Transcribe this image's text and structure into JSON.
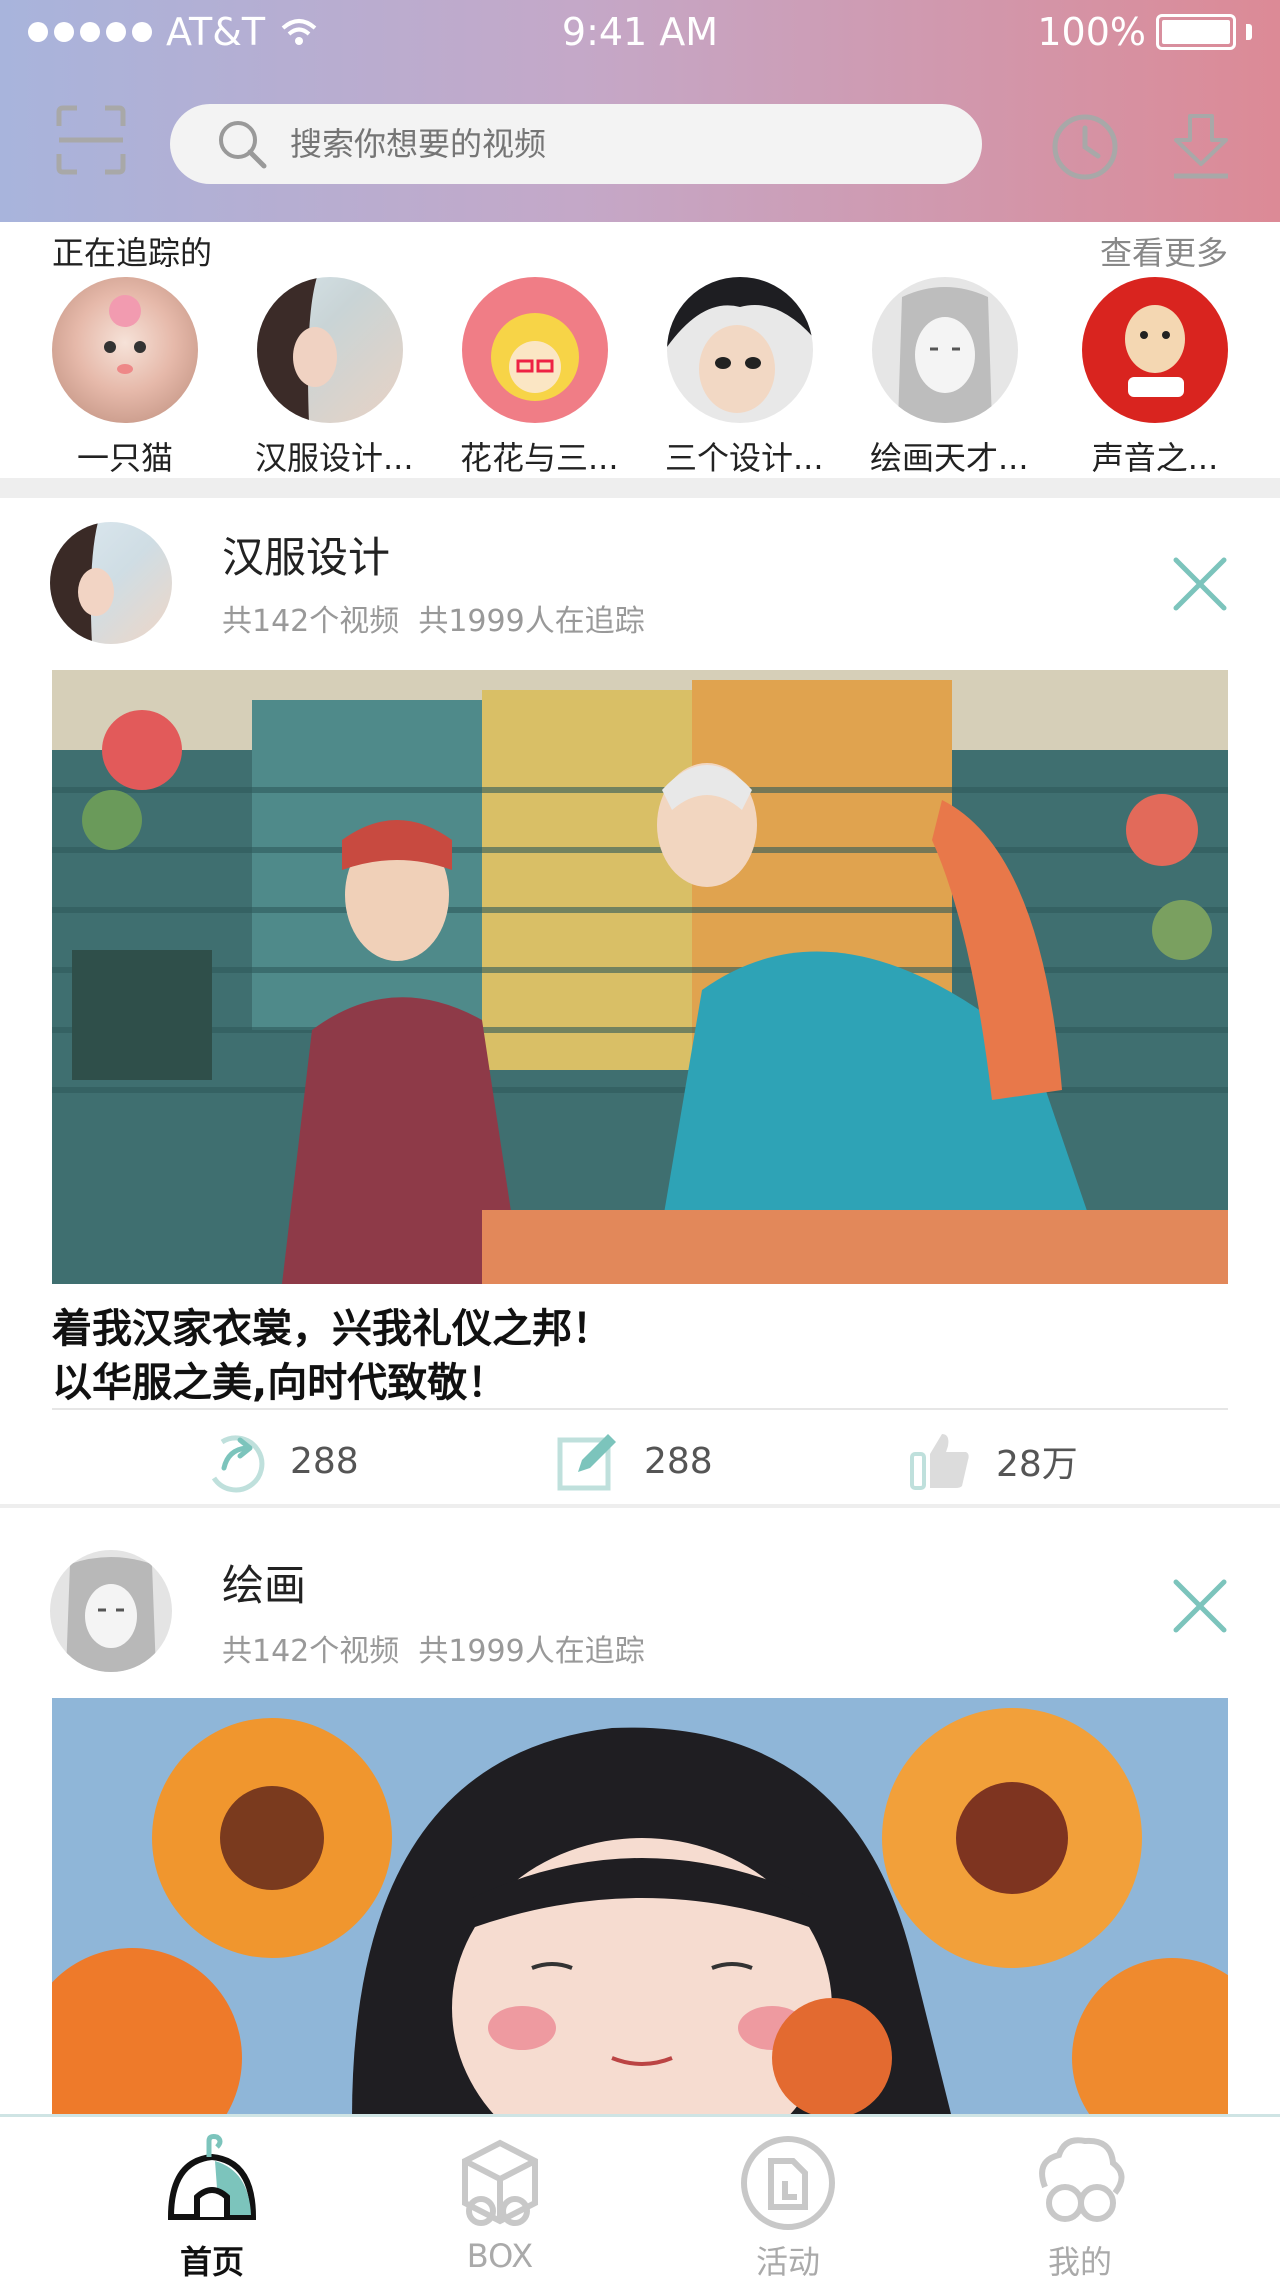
{
  "status_bar": {
    "carrier": "AT&T",
    "time": "9:41 AM",
    "battery": "100%"
  },
  "search": {
    "placeholder": "搜索你想要的视频"
  },
  "following": {
    "title": "正在追踪的",
    "see_more": "查看更多",
    "items": [
      {
        "name": "一只猫"
      },
      {
        "name": "汉服设计..."
      },
      {
        "name": "花花与三..."
      },
      {
        "name": "三个设计..."
      },
      {
        "name": "绘画天才..."
      },
      {
        "name": "声音之..."
      }
    ]
  },
  "posts": [
    {
      "title": "汉服设计",
      "videos": "共142个视频",
      "followers": "共1999人在追踪",
      "caption_line1": "着我汉家衣裳，兴我礼仪之邦！",
      "caption_line2": "以华服之美,向时代致敬！",
      "shares": "288",
      "comments": "288",
      "likes": "28万"
    },
    {
      "title": "绘画",
      "videos": "共142个视频",
      "followers": "共1999人在追踪"
    }
  ],
  "tabs": [
    {
      "label": "首页"
    },
    {
      "label": "BOX"
    },
    {
      "label": "活动"
    },
    {
      "label": "我的"
    }
  ],
  "colors": {
    "accent": "#7cc4bc",
    "header_start": "#a8b4dc",
    "header_end": "#dc8a96"
  }
}
